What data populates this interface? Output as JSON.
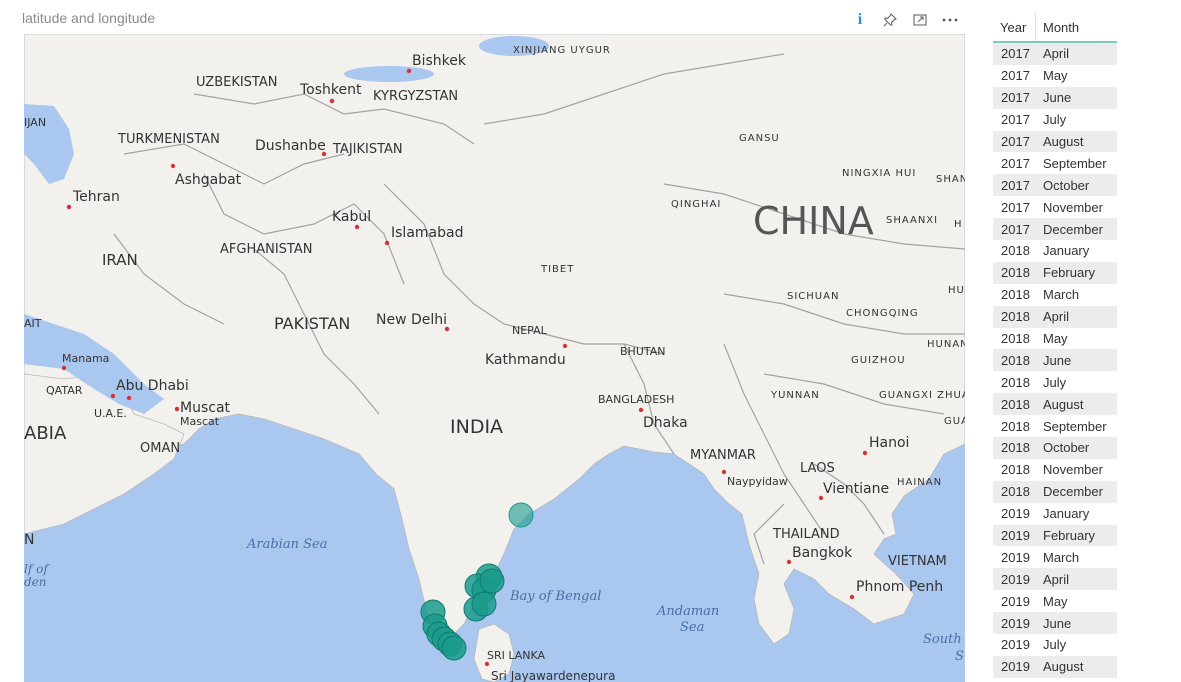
{
  "visual": {
    "title": "latitude and longitude",
    "toolbar": {
      "info_icon": "i"
    }
  },
  "map": {
    "countries": [
      "UZBEKISTAN",
      "KYRGYZSTAN",
      "TURKMENISTAN",
      "TAJIKISTAN",
      "AFGHANISTAN",
      "IRAN",
      "PAKISTAN",
      "NEPAL",
      "BHUTAN",
      "BANGLADESH",
      "INDIA",
      "MYANMAR",
      "LAOS",
      "THAILAND",
      "VIETNAM",
      "CHINA",
      "OMAN",
      "QATAR",
      "U.A.E.",
      "SRI LANKA",
      "ABIA",
      "IJAN",
      "AIT",
      "N"
    ],
    "regions": [
      "XINJIANG UYGUR",
      "GANSU",
      "QINGHAI",
      "NINGXIA HUI",
      "SHAN",
      "TIBET",
      "SICHUAN",
      "SHAANXI",
      "CHONGQING",
      "GUIZHOU",
      "HUNAN",
      "YUNNAN",
      "GUANGXI ZHUANG",
      "HAINAN",
      "HU",
      "H",
      "GUA"
    ],
    "cities": [
      "Bishkek",
      "Toshkent",
      "Dushanbe",
      "Ashgabat",
      "Tehran",
      "Kabul",
      "Islamabad",
      "New Delhi",
      "Kathmandu",
      "Dhaka",
      "Manama",
      "Abu Dhabi",
      "Muscat",
      "Mascat",
      "Hanoi",
      "Naypyidaw",
      "Vientiane",
      "Bangkok",
      "Phnom Penh",
      "Sri Jayawardenepura"
    ],
    "seas": [
      "Arabian Sea",
      "Bay of Bengal",
      "Andaman",
      "Sea",
      "South",
      "S",
      "lf of",
      "den"
    ],
    "bubble_color": "#1a9b8c",
    "land_color": "#f2f1ee",
    "water_color": "#a9c7ef"
  },
  "table": {
    "headers": [
      "Year",
      "Month"
    ],
    "rows": [
      [
        "2017",
        "April"
      ],
      [
        "2017",
        "May"
      ],
      [
        "2017",
        "June"
      ],
      [
        "2017",
        "July"
      ],
      [
        "2017",
        "August"
      ],
      [
        "2017",
        "September"
      ],
      [
        "2017",
        "October"
      ],
      [
        "2017",
        "November"
      ],
      [
        "2017",
        "December"
      ],
      [
        "2018",
        "January"
      ],
      [
        "2018",
        "February"
      ],
      [
        "2018",
        "March"
      ],
      [
        "2018",
        "April"
      ],
      [
        "2018",
        "May"
      ],
      [
        "2018",
        "June"
      ],
      [
        "2018",
        "July"
      ],
      [
        "2018",
        "August"
      ],
      [
        "2018",
        "September"
      ],
      [
        "2018",
        "October"
      ],
      [
        "2018",
        "November"
      ],
      [
        "2018",
        "December"
      ],
      [
        "2019",
        "January"
      ],
      [
        "2019",
        "February"
      ],
      [
        "2019",
        "March"
      ],
      [
        "2019",
        "April"
      ],
      [
        "2019",
        "May"
      ],
      [
        "2019",
        "June"
      ],
      [
        "2019",
        "July"
      ],
      [
        "2019",
        "August"
      ]
    ]
  }
}
